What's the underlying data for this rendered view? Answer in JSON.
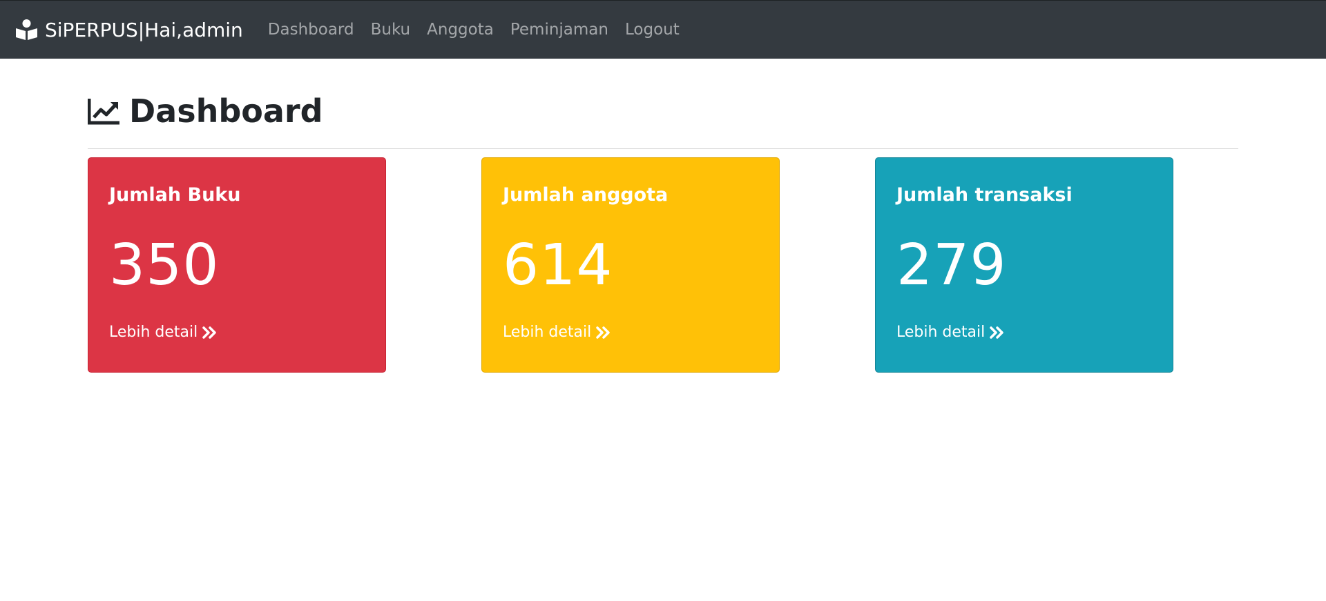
{
  "navbar": {
    "brand": "SiPERPUS|Hai,admin",
    "brand_icon": "reader-book-icon",
    "links": [
      "Dashboard",
      "Buku",
      "Anggota",
      "Peminjaman",
      "Logout"
    ],
    "background": "#343a40"
  },
  "page": {
    "title": "Dashboard",
    "title_icon": "chart-line-icon"
  },
  "cards": [
    {
      "title": "Jumlah Buku",
      "value": "350",
      "link": "Lebih detail",
      "color": "#dc3545",
      "link_icon": "double-chevron-right-icon"
    },
    {
      "title": "Jumlah anggota",
      "value": "614",
      "link": "Lebih detail",
      "color": "#ffc107",
      "link_icon": "double-chevron-right-icon"
    },
    {
      "title": "Jumlah transaksi",
      "value": "279",
      "link": "Lebih detail",
      "color": "#17a2b8",
      "link_icon": "double-chevron-right-icon"
    }
  ]
}
